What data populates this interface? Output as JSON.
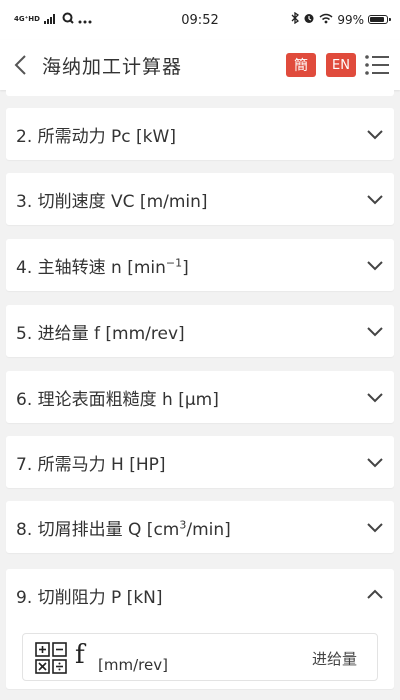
{
  "status_bar": {
    "network": "4G⁺HD",
    "time": "09:52",
    "battery": "99%",
    "battery_level": 0.99
  },
  "header": {
    "title": "海纳加工计算器",
    "lang_zh": "簡",
    "lang_en": "EN"
  },
  "items": [
    {
      "pre": "2. 所需动力 Pc [kW]",
      "sup": "",
      "post": "",
      "expanded": false
    },
    {
      "pre": "3. 切削速度 VC [m/min]",
      "sup": "",
      "post": "",
      "expanded": false
    },
    {
      "pre": "4. 主轴转速 n [min",
      "sup": "−1",
      "post": "]",
      "expanded": false
    },
    {
      "pre": "5. 进给量 f [mm/rev]",
      "sup": "",
      "post": "",
      "expanded": false
    },
    {
      "pre": "6. 理论表面粗糙度 h [µm]",
      "sup": "",
      "post": "",
      "expanded": false
    },
    {
      "pre": "7. 所需马力 H [HP]",
      "sup": "",
      "post": "",
      "expanded": false
    },
    {
      "pre": "8. 切屑排出量 Q [cm",
      "sup": "3",
      "post": "/min]",
      "expanded": false
    },
    {
      "pre": "9. 切削阻力 P [kN]",
      "sup": "",
      "post": "",
      "expanded": true
    }
  ],
  "expanded_panel": {
    "symbol": "f",
    "unit": "[mm/rev]",
    "name": "进给量",
    "icon": "calculator-icon"
  },
  "colors": {
    "accent": "#e04b3c",
    "background": "#f2f2f2",
    "card": "#ffffff",
    "text": "#333333"
  }
}
